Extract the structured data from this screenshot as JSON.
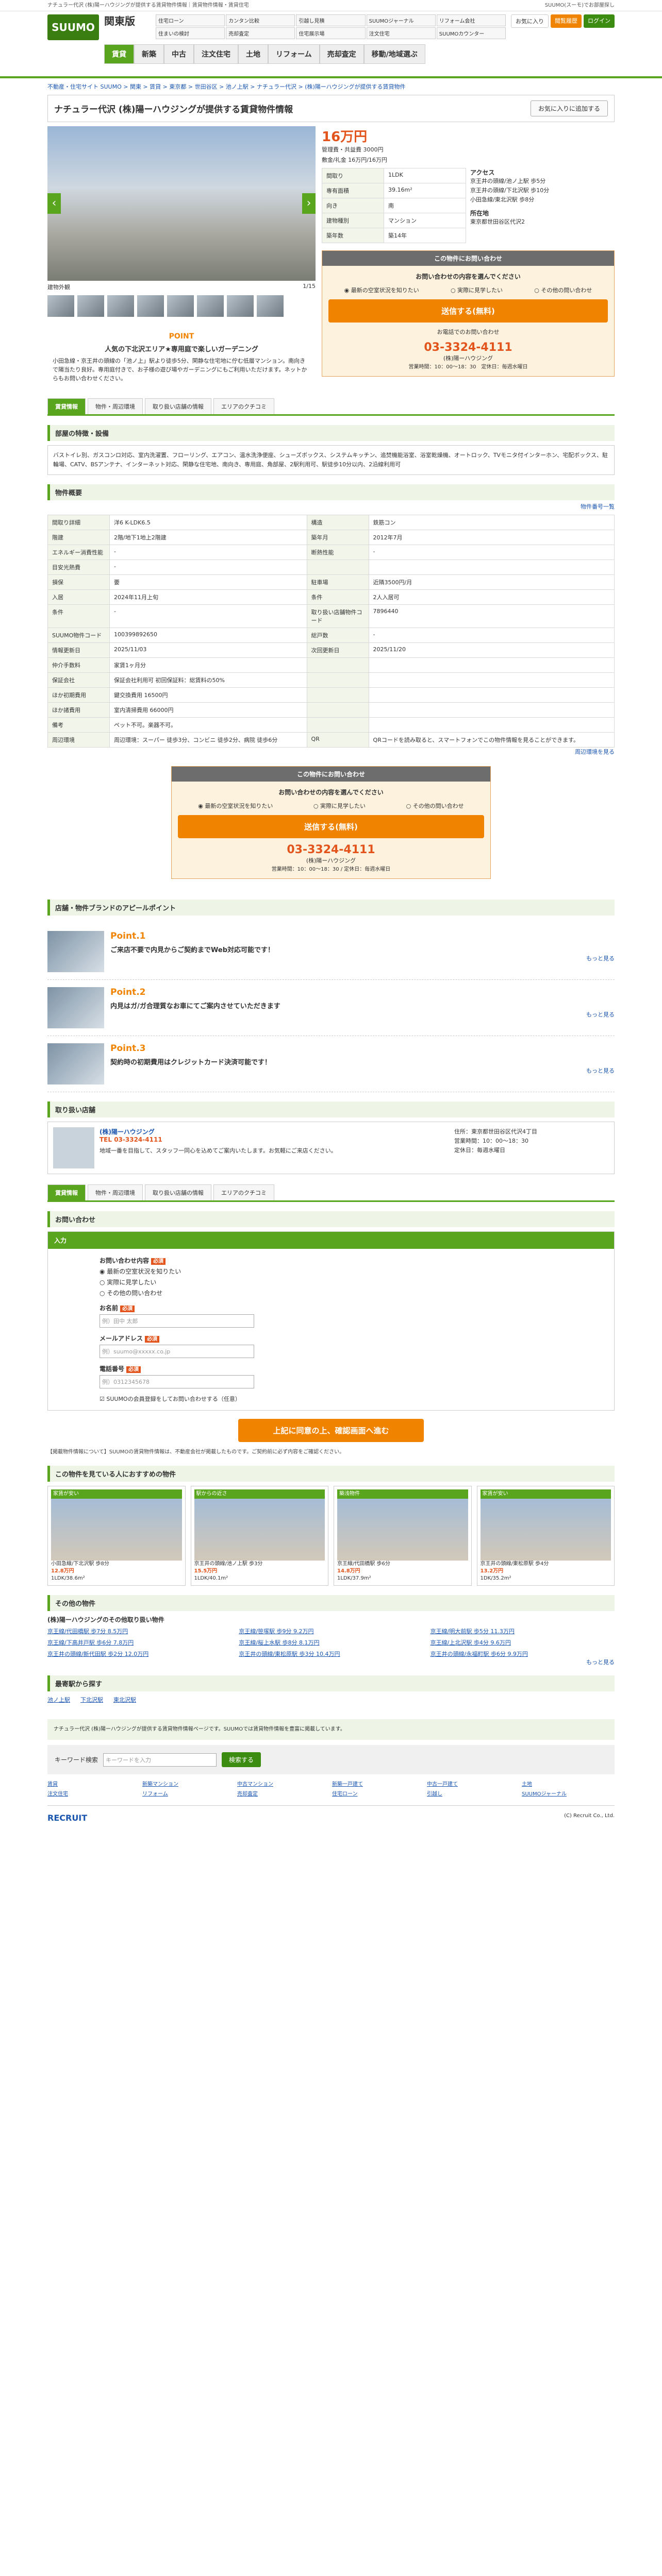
{
  "topbar": {
    "text": "ナチュラー代沢 (株)陽ーハウジングが提供する賃貸物件情報｜賃貸物件情報・賃貸住宅",
    "right": "SUUMO(スーモ)でお部屋探し"
  },
  "header": {
    "logo": "SUUMO",
    "region": "関東版",
    "quick": [
      "住宅ローン",
      "カンタン比較",
      "引越し見積",
      "SUUMOジャーナル",
      "リフォーム会社",
      "住まいの検討",
      "売却査定",
      "住宅展示場",
      "注文住宅",
      "SUUMOカウンター"
    ],
    "btn_fav": "お気に入り",
    "btn_history": "閲覧履歴",
    "btn_login": "ログイン",
    "nav": [
      "賃貸",
      "新築",
      "中古",
      "注文住宅",
      "土地",
      "リフォーム",
      "売却査定",
      "移動/地域選ぶ"
    ]
  },
  "breadcrumb": "不動産・住宅サイト SUUMO > 関東 > 賃貸 > 東京都 > 世田谷区 > 池ノ上駅 > ナチュラー代沢 > (株)陽ーハウジングが提供する賃貸物件",
  "title": "ナチュラー代沢 (株)陽ーハウジングが提供する賃貸物件情報",
  "fav_button": "お気に入りに追加する",
  "gallery": {
    "caption": "建物外観",
    "photo_count": "1/15"
  },
  "point": {
    "head": "POINT",
    "title": "人気の下北沢エリア★専用庭で楽しいガーデニング",
    "body": "小田急線・京王井の頭線の「池ノ上」駅より徒歩5分、閑静な住宅地に佇む低層マンション。南向きで陽当たり良好。専用庭付きで、お子様の遊び場やガーデニングにもご利用いただけます。ネットからもお問い合わせください。"
  },
  "summary": {
    "price": "16万円",
    "admin_label": "管理費・共益費",
    "admin": "3000円",
    "deposit_label": "敷金/礼金",
    "deposit": "16万円/16万円",
    "rows": [
      [
        "間取り",
        "1LDK"
      ],
      [
        "専有面積",
        "39.16m²"
      ],
      [
        "向き",
        "南"
      ],
      [
        "建物種別",
        "マンション"
      ],
      [
        "築年数",
        "築14年"
      ]
    ],
    "access_label": "アクセス",
    "access": [
      "京王井の頭線/池ノ上駅 歩5分",
      "京王井の頭線/下北沢駅 歩10分",
      "小田急線/東北沢駅 歩8分"
    ],
    "address_label": "所在地",
    "address": "東京都世田谷区代沢2"
  },
  "contact": {
    "head": "この物件にお問い合わせ",
    "prompt": "お問い合わせの内容を選んでください",
    "opts": [
      "最新の空室状況を知りたい",
      "実際に見学したい",
      "その他の問い合わせ"
    ],
    "button": "送信する(無料)",
    "tel_label": "お電話でのお問い合わせ",
    "tel": "03-3324-4111",
    "company": "(株)陽ーハウジング",
    "hours": "営業時間：10：00～18：30　定休日：毎週水曜日"
  },
  "tabs": [
    "賃貸情報",
    "物件・周辺環境",
    "取り扱い店舗の情報",
    "エリアのクチコミ"
  ],
  "features": {
    "head": "部屋の特徴・設備",
    "text": "バストイレ別、ガスコンロ対応、室内洗濯置、フローリング、エアコン、温水洗浄便座、シューズボックス、システムキッチン、追焚機能浴室、浴室乾燥機、オートロック、TVモニタ付インターホン、宅配ボックス、駐輪場、CATV、BSアンテナ、インターネット対応、閑静な住宅地、南向き、専用庭、角部屋、2駅利用可、駅徒歩10分以内、2沿線利用可"
  },
  "overview": {
    "head": "物件概要",
    "more": "物件番号一覧",
    "rows": [
      [
        "間取り詳細",
        "洋6 K-LDK6.5",
        "構造",
        "鉄筋コン"
      ],
      [
        "階建",
        "2階/地下1地上2階建",
        "築年月",
        "2012年7月"
      ],
      [
        "エネルギー消費性能",
        "-",
        "断熱性能",
        "-"
      ],
      [
        "目安光熱費",
        "-",
        "",
        ""
      ],
      [
        "損保",
        "要",
        "駐車場",
        "近隣3500円/月"
      ],
      [
        "入居",
        "2024年11月上旬",
        "条件",
        "2人入居可"
      ],
      [
        "条件",
        "-",
        "取り扱い店舗物件コード",
        "7896440"
      ],
      [
        "SUUMO物件コード",
        "100399892650",
        "総戸数",
        "-"
      ],
      [
        "情報更新日",
        "2025/11/03",
        "次回更新日",
        "2025/11/20"
      ],
      [
        "仲介手数料",
        "家賃1ヶ月分",
        "",
        ""
      ],
      [
        "保証会社",
        "保証会社利用可 初回保証料：総賃料の50%",
        "",
        ""
      ],
      [
        "ほか初期費用",
        "鍵交換費用 16500円",
        "",
        ""
      ],
      [
        "ほか諸費用",
        "室内清掃費用 66000円",
        "",
        ""
      ],
      [
        "備考",
        "ペット不可。楽器不可。",
        "",
        ""
      ],
      [
        "周辺環境",
        "周辺環境：スーパー 徒歩3分、コンビニ 徒歩2分、病院 徒歩6分",
        "QR",
        "QRコードを読み取ると、スマートフォンでこの物件情報を見ることができます。"
      ]
    ],
    "map_link": "周辺環境を見る"
  },
  "contact2": {
    "head": "この物件にお問い合わせ",
    "prompt": "お問い合わせの内容を選んでください",
    "opts": [
      "最新の空室状況を知りたい",
      "実際に見学したい",
      "その他の問い合わせ"
    ],
    "button": "送信する(無料)",
    "tel": "03-3324-4111",
    "company": "(株)陽ーハウジング",
    "hours": "営業時間：10：00～18：30 / 定休日：毎週水曜日"
  },
  "appeal": {
    "head": "店舗・物件ブランドのアピールポイント",
    "points": [
      {
        "num": "Point.1",
        "text": "ご来店不要で内見からご契約までWeb対応可能です！"
      },
      {
        "num": "Point.2",
        "text": "内見はガ/ガ合理質なお車にてご案内させていただきます"
      },
      {
        "num": "Point.3",
        "text": "契約時の初期費用はクレジットカード決済可能です！"
      }
    ],
    "more": "もっと見る"
  },
  "shop": {
    "head": "取り扱い店舗",
    "name": "(株)陽ーハウジング",
    "tel": "TEL 03-3324-4111",
    "desc": "地域一番を目指して、スタッフ一同心を込めてご案内いたします。お気軽にご来店ください。",
    "addr": "住所：東京都世田谷区代沢4丁目",
    "hours": "営業時間：10：00～18：30",
    "holiday": "定休日：毎週水曜日"
  },
  "form": {
    "head": "お問い合わせ",
    "step": "入力",
    "kind_label": "お問い合わせ内容",
    "req": "必須",
    "kinds": [
      "最新の空室状況を知りたい",
      "実際に見学したい",
      "その他の問い合わせ"
    ],
    "name_label": "お名前",
    "name_ph": "例）田中 太郎",
    "mail_label": "メールアドレス",
    "mail_ph": "例）suumo@xxxxx.co.jp",
    "tel_label": "電話番号",
    "tel_ph": "例）0312345678",
    "agree": "SUUMOの会員登録をしてお問い合わせする（任意）",
    "submit": "上記に同意の上、確認画面へ進む"
  },
  "notes": "【掲載物件情報について】SUUMOの賃貸物件情報は、不動産会社が掲載したものです。ご契約前に必ず内容をご確認ください。",
  "similar": {
    "head": "この物件を見ている人におすすめの物件",
    "cards": [
      {
        "tag": "家賃が安い",
        "name": "小田急線/下北沢駅 歩8分",
        "price": "12.8万円",
        "size": "1LDK/38.6m²"
      },
      {
        "tag": "駅からの近さ",
        "name": "京王井の頭線/池ノ上駅 歩3分",
        "price": "15.5万円",
        "size": "1LDK/40.1m²"
      },
      {
        "tag": "築浅物件",
        "name": "京王線/代田橋駅 歩6分",
        "price": "14.8万円",
        "size": "1LDK/37.9m²"
      },
      {
        "tag": "家賃が安い",
        "name": "京王井の頭線/東松原駅 歩4分",
        "price": "13.2万円",
        "size": "1DK/35.2m²"
      }
    ]
  },
  "others": {
    "head": "その他の物件",
    "sub": "(株)陽ーハウジングのその他取り扱い物件",
    "items": [
      "京王線/代田橋駅 歩7分 8.5万円",
      "京王線/笹塚駅 歩9分 9.2万円",
      "京王線/明大前駅 歩5分 11.3万円",
      "京王線/下高井戸駅 歩6分 7.8万円",
      "京王線/桜上水駅 歩8分 8.1万円",
      "京王線/上北沢駅 歩4分 9.6万円",
      "京王井の頭線/新代田駅 歩2分 12.0万円",
      "京王井の頭線/東松原駅 歩3分 10.4万円",
      "京王井の頭線/永福町駅 歩6分 9.9万円"
    ],
    "more": "もっと見る"
  },
  "related": {
    "head": "最寄駅から探す",
    "stations": [
      "池ノ上駅",
      "下北沢駅",
      "東北沢駅"
    ]
  },
  "footer": {
    "band": "ナチュラー代沢 (株)陽ーハウジングが提供する賃貸物件情報ページです。SUUMOでは賃貸物件情報を豊富に掲載しています。",
    "search_label": "キーワード検索",
    "search_ph": "キーワードを入力",
    "search_btn": "検索する",
    "links": [
      "賃貸",
      "新築マンション",
      "中古マンション",
      "新築一戸建て",
      "中古一戸建て",
      "土地",
      "注文住宅",
      "リフォーム",
      "売却査定",
      "住宅ローン",
      "引越し",
      "SUUMOジャーナル"
    ],
    "company": "RECRUIT",
    "copy": "(C) Recruit Co., Ltd."
  }
}
